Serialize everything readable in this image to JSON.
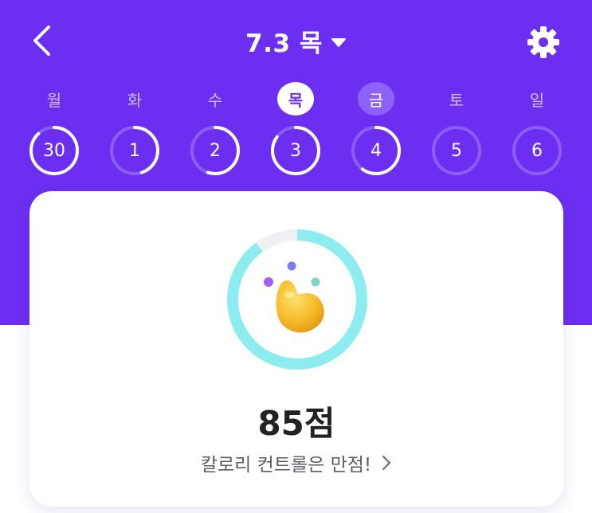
{
  "header": {
    "title": "7.3 목",
    "back_icon": "chevron-left-icon",
    "caret_icon": "caret-down-icon",
    "settings_icon": "gear-icon"
  },
  "weekdays": [
    {
      "label": "월",
      "state": "normal"
    },
    {
      "label": "화",
      "state": "normal"
    },
    {
      "label": "수",
      "state": "normal"
    },
    {
      "label": "목",
      "state": "selected"
    },
    {
      "label": "금",
      "state": "today"
    },
    {
      "label": "토",
      "state": "normal"
    },
    {
      "label": "일",
      "state": "normal"
    }
  ],
  "days": [
    {
      "num": "30",
      "progress": 0.88
    },
    {
      "num": "1",
      "progress": 0.45
    },
    {
      "num": "2",
      "progress": 0.55
    },
    {
      "num": "3",
      "progress": 0.85
    },
    {
      "num": "4",
      "progress": 0.6
    },
    {
      "num": "5",
      "progress": 0
    },
    {
      "num": "6",
      "progress": 0
    }
  ],
  "card": {
    "score": "85점",
    "score_progress": 0.9,
    "message": "칼로리 컨트롤은 만점!",
    "message_icon": "chevron-right-icon",
    "illustration": "character-illustration"
  },
  "colors": {
    "primary": "#6c2ff2",
    "ring": "#8cecef",
    "ring_track": "#eef0f3"
  }
}
